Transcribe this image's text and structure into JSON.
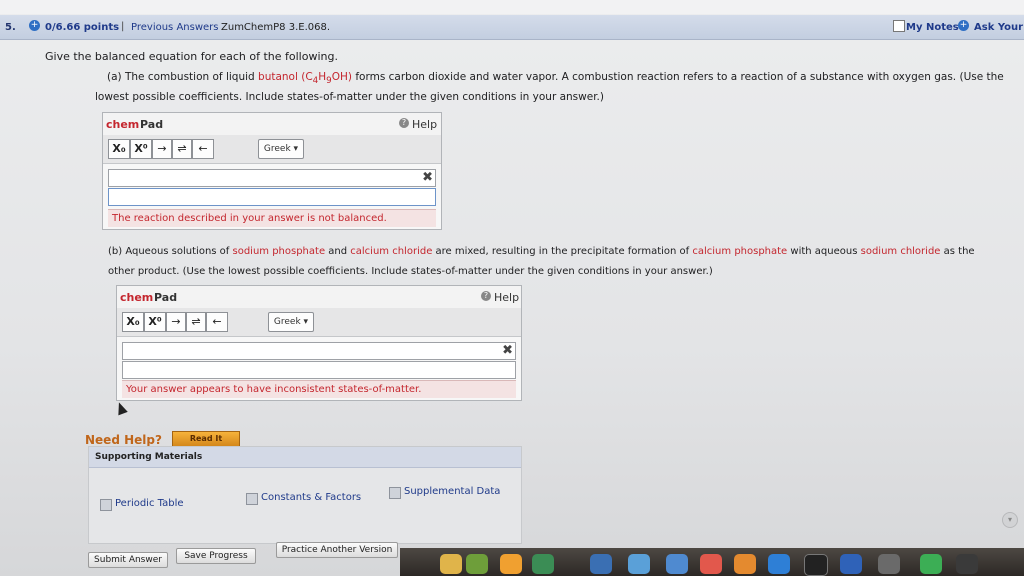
{
  "header": {
    "question_number": "5.",
    "points": "0/6.66 points",
    "separator": "|",
    "previous_answers": "Previous Answers",
    "question_id": "ZumChemP8 3.E.068.",
    "my_notes": "My Notes",
    "ask_your_teacher": "Ask Your T"
  },
  "prompt": {
    "intro": "Give the balanced equation for each of the following.",
    "part_a": {
      "prefix": "(a) The combustion of liquid ",
      "compound": "butanol",
      "formula_open": " (C",
      "sub1": "4",
      "formula_h": "H",
      "sub2": "9",
      "formula_close": "OH)",
      "rest_line1": " forms carbon dioxide and water vapor. A combustion reaction refers to a reaction of a substance with oxygen gas. (Use the",
      "line2": "lowest possible coefficients. Include states-of-matter under the given conditions in your answer.)"
    },
    "part_b": {
      "p1": "(b) Aqueous solutions of ",
      "c1": "sodium phosphate",
      "p2": " and ",
      "c2": "calcium chloride",
      "p3": " are mixed, resulting in the precipitate formation of ",
      "c3": "calcium phosphate",
      "p4": " with aqueous ",
      "c4": "sodium chloride",
      "p5": " as the",
      "line2": "other product. (Use the lowest possible coefficients. Include states-of-matter under the given conditions in your answer.)"
    }
  },
  "chempad": {
    "chem": "chem",
    "pad": "Pad",
    "help": "Help",
    "help_icon": "?",
    "sub_btn": "X₀",
    "sup_btn": "X⁰",
    "arrow_btn": "→",
    "equil_btn": "⇌",
    "back_btn": "←",
    "greek": "Greek ▾",
    "clear": "✖"
  },
  "errors": {
    "a": "The reaction described in your answer is not balanced.",
    "b": "Your answer appears to have inconsistent states-of-matter."
  },
  "help_section": {
    "need_help": "Need Help?",
    "read_it": "Read It",
    "supporting_materials": "Supporting Materials",
    "periodic_table": "Periodic Table",
    "constants": "Constants & Factors",
    "supplemental": "Supplemental Data"
  },
  "buttons": {
    "submit": "Submit Answer",
    "save": "Save Progress",
    "practice": "Practice Another Version"
  },
  "dock_icons": [
    "app-icon",
    "app-icon",
    "app-icon",
    "app-icon",
    "app-icon",
    "app-icon",
    "app-icon",
    "app-icon",
    "app-icon",
    "app-icon",
    "app-icon",
    "app-icon"
  ],
  "colors": {
    "accent_red": "#c4262e",
    "link_blue": "#1f3a8a",
    "help_orange": "#c0661b"
  }
}
